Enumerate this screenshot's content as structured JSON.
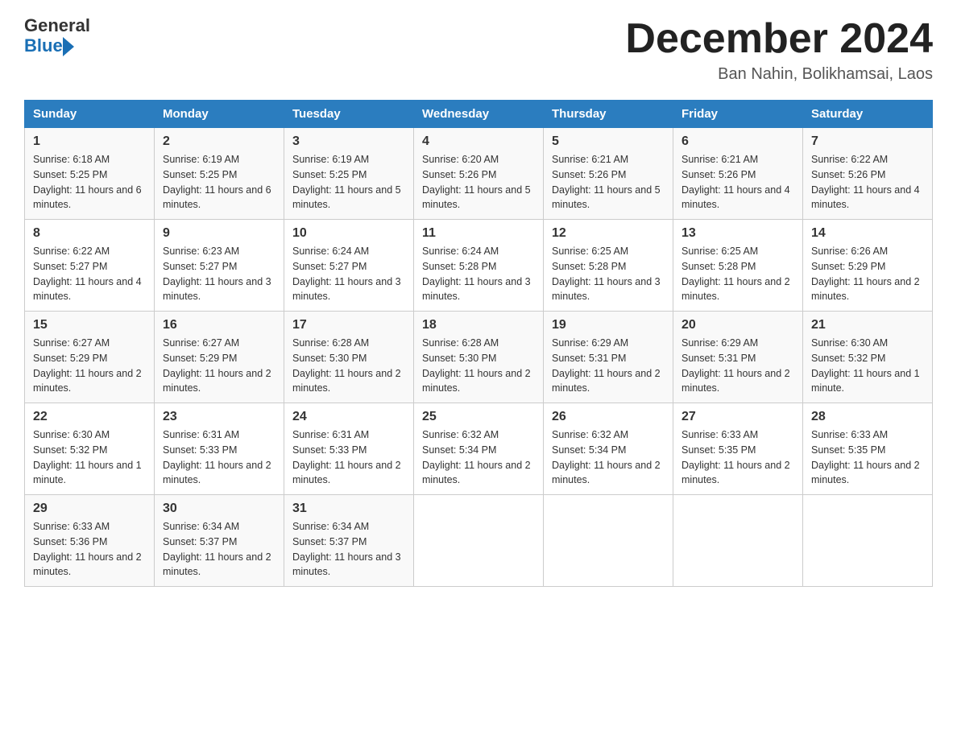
{
  "logo": {
    "text_general": "General",
    "text_blue": "Blue"
  },
  "header": {
    "month_year": "December 2024",
    "location": "Ban Nahin, Bolikhamsai, Laos"
  },
  "days_of_week": [
    "Sunday",
    "Monday",
    "Tuesday",
    "Wednesday",
    "Thursday",
    "Friday",
    "Saturday"
  ],
  "weeks": [
    [
      {
        "day": "1",
        "sunrise": "6:18 AM",
        "sunset": "5:25 PM",
        "daylight": "11 hours and 6 minutes."
      },
      {
        "day": "2",
        "sunrise": "6:19 AM",
        "sunset": "5:25 PM",
        "daylight": "11 hours and 6 minutes."
      },
      {
        "day": "3",
        "sunrise": "6:19 AM",
        "sunset": "5:25 PM",
        "daylight": "11 hours and 5 minutes."
      },
      {
        "day": "4",
        "sunrise": "6:20 AM",
        "sunset": "5:26 PM",
        "daylight": "11 hours and 5 minutes."
      },
      {
        "day": "5",
        "sunrise": "6:21 AM",
        "sunset": "5:26 PM",
        "daylight": "11 hours and 5 minutes."
      },
      {
        "day": "6",
        "sunrise": "6:21 AM",
        "sunset": "5:26 PM",
        "daylight": "11 hours and 4 minutes."
      },
      {
        "day": "7",
        "sunrise": "6:22 AM",
        "sunset": "5:26 PM",
        "daylight": "11 hours and 4 minutes."
      }
    ],
    [
      {
        "day": "8",
        "sunrise": "6:22 AM",
        "sunset": "5:27 PM",
        "daylight": "11 hours and 4 minutes."
      },
      {
        "day": "9",
        "sunrise": "6:23 AM",
        "sunset": "5:27 PM",
        "daylight": "11 hours and 3 minutes."
      },
      {
        "day": "10",
        "sunrise": "6:24 AM",
        "sunset": "5:27 PM",
        "daylight": "11 hours and 3 minutes."
      },
      {
        "day": "11",
        "sunrise": "6:24 AM",
        "sunset": "5:28 PM",
        "daylight": "11 hours and 3 minutes."
      },
      {
        "day": "12",
        "sunrise": "6:25 AM",
        "sunset": "5:28 PM",
        "daylight": "11 hours and 3 minutes."
      },
      {
        "day": "13",
        "sunrise": "6:25 AM",
        "sunset": "5:28 PM",
        "daylight": "11 hours and 2 minutes."
      },
      {
        "day": "14",
        "sunrise": "6:26 AM",
        "sunset": "5:29 PM",
        "daylight": "11 hours and 2 minutes."
      }
    ],
    [
      {
        "day": "15",
        "sunrise": "6:27 AM",
        "sunset": "5:29 PM",
        "daylight": "11 hours and 2 minutes."
      },
      {
        "day": "16",
        "sunrise": "6:27 AM",
        "sunset": "5:29 PM",
        "daylight": "11 hours and 2 minutes."
      },
      {
        "day": "17",
        "sunrise": "6:28 AM",
        "sunset": "5:30 PM",
        "daylight": "11 hours and 2 minutes."
      },
      {
        "day": "18",
        "sunrise": "6:28 AM",
        "sunset": "5:30 PM",
        "daylight": "11 hours and 2 minutes."
      },
      {
        "day": "19",
        "sunrise": "6:29 AM",
        "sunset": "5:31 PM",
        "daylight": "11 hours and 2 minutes."
      },
      {
        "day": "20",
        "sunrise": "6:29 AM",
        "sunset": "5:31 PM",
        "daylight": "11 hours and 2 minutes."
      },
      {
        "day": "21",
        "sunrise": "6:30 AM",
        "sunset": "5:32 PM",
        "daylight": "11 hours and 1 minute."
      }
    ],
    [
      {
        "day": "22",
        "sunrise": "6:30 AM",
        "sunset": "5:32 PM",
        "daylight": "11 hours and 1 minute."
      },
      {
        "day": "23",
        "sunrise": "6:31 AM",
        "sunset": "5:33 PM",
        "daylight": "11 hours and 2 minutes."
      },
      {
        "day": "24",
        "sunrise": "6:31 AM",
        "sunset": "5:33 PM",
        "daylight": "11 hours and 2 minutes."
      },
      {
        "day": "25",
        "sunrise": "6:32 AM",
        "sunset": "5:34 PM",
        "daylight": "11 hours and 2 minutes."
      },
      {
        "day": "26",
        "sunrise": "6:32 AM",
        "sunset": "5:34 PM",
        "daylight": "11 hours and 2 minutes."
      },
      {
        "day": "27",
        "sunrise": "6:33 AM",
        "sunset": "5:35 PM",
        "daylight": "11 hours and 2 minutes."
      },
      {
        "day": "28",
        "sunrise": "6:33 AM",
        "sunset": "5:35 PM",
        "daylight": "11 hours and 2 minutes."
      }
    ],
    [
      {
        "day": "29",
        "sunrise": "6:33 AM",
        "sunset": "5:36 PM",
        "daylight": "11 hours and 2 minutes."
      },
      {
        "day": "30",
        "sunrise": "6:34 AM",
        "sunset": "5:37 PM",
        "daylight": "11 hours and 2 minutes."
      },
      {
        "day": "31",
        "sunrise": "6:34 AM",
        "sunset": "5:37 PM",
        "daylight": "11 hours and 3 minutes."
      },
      null,
      null,
      null,
      null
    ]
  ]
}
